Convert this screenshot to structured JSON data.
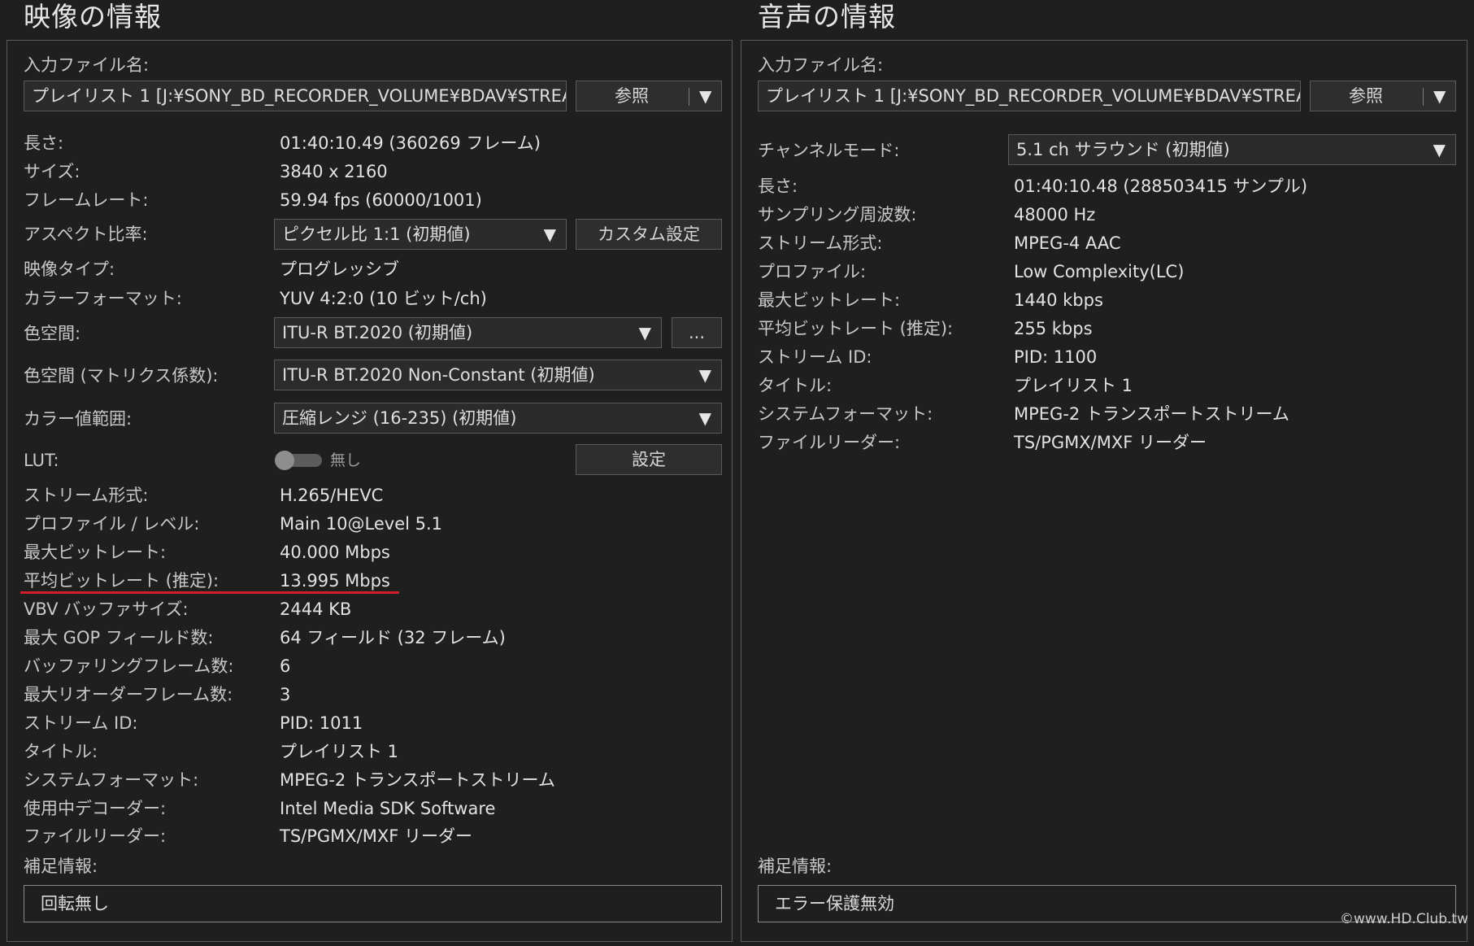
{
  "video": {
    "title": "映像の情報",
    "input_file_label": "入力ファイル名:",
    "input_file_value": "プレイリスト 1 [J:¥SONY_BD_RECORDER_VOLUME¥BDAV¥STREAM",
    "browse_label": "参照",
    "rows": [
      {
        "label": "長さ:",
        "value": "01:40:10.49 (360269 フレーム)"
      },
      {
        "label": "サイズ:",
        "value": "3840 x 2160"
      },
      {
        "label": "フレームレート:",
        "value": "59.94 fps (60000/1001)"
      },
      {
        "label": "アスペクト比率:"
      },
      {
        "label": "映像タイプ:",
        "value": "プログレッシブ"
      },
      {
        "label": "カラーフォーマット:",
        "value": "YUV 4:2:0 (10 ビット/ch)"
      },
      {
        "label": "色空間:"
      },
      {
        "label": "色空間 (マトリクス係数):"
      },
      {
        "label": "カラー値範囲:"
      },
      {
        "label": "LUT:"
      },
      {
        "label": "ストリーム形式:",
        "value": "H.265/HEVC"
      },
      {
        "label": "プロファイル / レベル:",
        "value": "Main 10@Level 5.1"
      },
      {
        "label": "最大ビットレート:",
        "value": "40.000 Mbps"
      },
      {
        "label": "平均ビットレート (推定):",
        "value": "13.995 Mbps"
      },
      {
        "label": "VBV バッファサイズ:",
        "value": "2444 KB"
      },
      {
        "label": "最大 GOP フィールド数:",
        "value": "64 フィールド (32 フレーム)"
      },
      {
        "label": "バッファリングフレーム数:",
        "value": "6"
      },
      {
        "label": "最大リオーダーフレーム数:",
        "value": "3"
      },
      {
        "label": "ストリーム ID:",
        "value": "PID: 1011"
      },
      {
        "label": "タイトル:",
        "value": "プレイリスト 1"
      },
      {
        "label": "システムフォーマット:",
        "value": "MPEG-2 トランスポートストリーム"
      },
      {
        "label": "使用中デコーダー:",
        "value": "Intel Media SDK Software"
      },
      {
        "label": "ファイルリーダー:",
        "value": "TS/PGMX/MXF リーダー"
      }
    ],
    "aspect_select": "ピクセル比 1:1 (初期値)",
    "custom_setting_label": "カスタム設定",
    "colorspace_select": "ITU-R BT.2020 (初期値)",
    "colorspace_more": "...",
    "matrix_select": "ITU-R BT.2020 Non-Constant (初期値)",
    "range_select": "圧縮レンジ (16-235) (初期値)",
    "lut_state": "無し",
    "lut_setting_label": "設定",
    "note_label": "補足情報:",
    "note_value": "回転無し"
  },
  "audio": {
    "title": "音声の情報",
    "input_file_label": "入力ファイル名:",
    "input_file_value": "プレイリスト 1 [J:¥SONY_BD_RECORDER_VOLUME¥BDAV¥STREAM",
    "browse_label": "参照",
    "channel_label": "チャンネルモード:",
    "channel_select": "5.1 ch サラウンド (初期値)",
    "rows": [
      {
        "label": "長さ:",
        "value": "01:40:10.48 (288503415 サンプル)"
      },
      {
        "label": "サンプリング周波数:",
        "value": "48000 Hz"
      },
      {
        "label": "ストリーム形式:",
        "value": "MPEG-4 AAC"
      },
      {
        "label": "プロファイル:",
        "value": "Low Complexity(LC)"
      },
      {
        "label": "最大ビットレート:",
        "value": "1440 kbps"
      },
      {
        "label": "平均ビットレート (推定):",
        "value": "255 kbps"
      },
      {
        "label": "ストリーム ID:",
        "value": "PID: 1100"
      },
      {
        "label": "タイトル:",
        "value": "プレイリスト 1"
      },
      {
        "label": "システムフォーマット:",
        "value": "MPEG-2 トランスポートストリーム"
      },
      {
        "label": "ファイルリーダー:",
        "value": "TS/PGMX/MXF リーダー"
      }
    ],
    "note_label": "補足情報:",
    "note_value": "エラー保護無効"
  },
  "watermark": "©www.HD.Club.tw",
  "colors": {
    "highlight": "#d21f2b",
    "background": "#1f1f1f",
    "border": "#5a5a5a"
  }
}
